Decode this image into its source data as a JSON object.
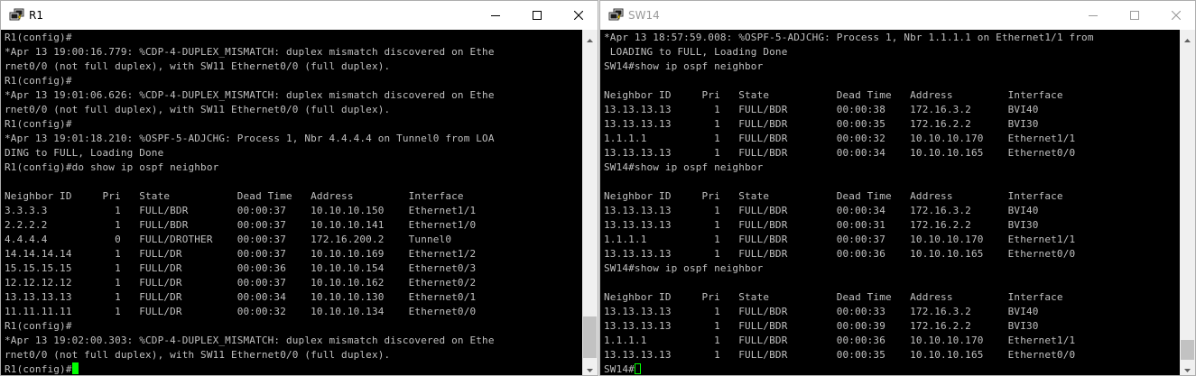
{
  "windows": [
    {
      "id": "r1",
      "title": "R1",
      "active": true,
      "icon": "putty-terminal-icon",
      "lines": [
        "R1(config)#",
        "*Apr 13 19:00:16.779: %CDP-4-DUPLEX_MISMATCH: duplex mismatch discovered on Ethe",
        "rnet0/0 (not full duplex), with SW11 Ethernet0/0 (full duplex).",
        "R1(config)#",
        "*Apr 13 19:01:06.626: %CDP-4-DUPLEX_MISMATCH: duplex mismatch discovered on Ethe",
        "rnet0/0 (not full duplex), with SW11 Ethernet0/0 (full duplex).",
        "R1(config)#",
        "*Apr 13 19:01:18.210: %OSPF-5-ADJCHG: Process 1, Nbr 4.4.4.4 on Tunnel0 from LOA",
        "DING to FULL, Loading Done",
        "R1(config)#do show ip ospf neighbor",
        "",
        "Neighbor ID     Pri   State           Dead Time   Address         Interface",
        "3.3.3.3           1   FULL/BDR        00:00:37    10.10.10.150    Ethernet1/1",
        "2.2.2.2           1   FULL/BDR        00:00:37    10.10.10.141    Ethernet1/0",
        "4.4.4.4           0   FULL/DROTHER    00:00:37    172.16.200.2    Tunnel0",
        "14.14.14.14       1   FULL/DR         00:00:37    10.10.10.169    Ethernet1/2",
        "15.15.15.15       1   FULL/DR         00:00:36    10.10.10.154    Ethernet0/3",
        "12.12.12.12       1   FULL/DR         00:00:37    10.10.10.162    Ethernet0/2",
        "13.13.13.13       1   FULL/DR         00:00:34    10.10.10.130    Ethernet0/1",
        "11.11.11.11       1   FULL/DR         00:00:32    10.10.10.134    Ethernet0/0",
        "R1(config)#",
        "*Apr 13 19:02:00.303: %CDP-4-DUPLEX_MISMATCH: duplex mismatch discovered on Ethe",
        "rnet0/0 (not full duplex), with SW11 Ethernet0/0 (full duplex).",
        "R1(config)#"
      ]
    },
    {
      "id": "sw14",
      "title": "SW14",
      "active": false,
      "icon": "putty-terminal-icon",
      "lines": [
        "*Apr 13 18:57:59.008: %OSPF-5-ADJCHG: Process 1, Nbr 1.1.1.1 on Ethernet1/1 from",
        " LOADING to FULL, Loading Done",
        "SW14#show ip ospf neighbor",
        "",
        "Neighbor ID     Pri   State           Dead Time   Address         Interface",
        "13.13.13.13       1   FULL/BDR        00:00:38    172.16.3.2      BVI40",
        "13.13.13.13       1   FULL/BDR        00:00:35    172.16.2.2      BVI30",
        "1.1.1.1           1   FULL/BDR        00:00:32    10.10.10.170    Ethernet1/1",
        "13.13.13.13       1   FULL/BDR        00:00:34    10.10.10.165    Ethernet0/0",
        "SW14#show ip ospf neighbor",
        "",
        "Neighbor ID     Pri   State           Dead Time   Address         Interface",
        "13.13.13.13       1   FULL/BDR        00:00:34    172.16.3.2      BVI40",
        "13.13.13.13       1   FULL/BDR        00:00:31    172.16.2.2      BVI30",
        "1.1.1.1           1   FULL/BDR        00:00:37    10.10.10.170    Ethernet1/1",
        "13.13.13.13       1   FULL/BDR        00:00:36    10.10.10.165    Ethernet0/0",
        "SW14#show ip ospf neighbor",
        "",
        "Neighbor ID     Pri   State           Dead Time   Address         Interface",
        "13.13.13.13       1   FULL/BDR        00:00:33    172.16.3.2      BVI40",
        "13.13.13.13       1   FULL/BDR        00:00:39    172.16.2.2      BVI30",
        "1.1.1.1           1   FULL/BDR        00:00:36    10.10.10.170    Ethernet1/1",
        "13.13.13.13       1   FULL/BDR        00:00:35    10.10.10.165    Ethernet0/0",
        "SW14#"
      ]
    }
  ],
  "colors": {
    "terminal_bg": "#000000",
    "terminal_fg": "#c0c0c0",
    "cursor": "#00ff00",
    "titlebar_bg": "#ffffff",
    "inactive_title": "#9a9a9a"
  },
  "controls": {
    "minimize": "minimize-icon",
    "maximize": "maximize-icon",
    "close": "close-icon"
  }
}
